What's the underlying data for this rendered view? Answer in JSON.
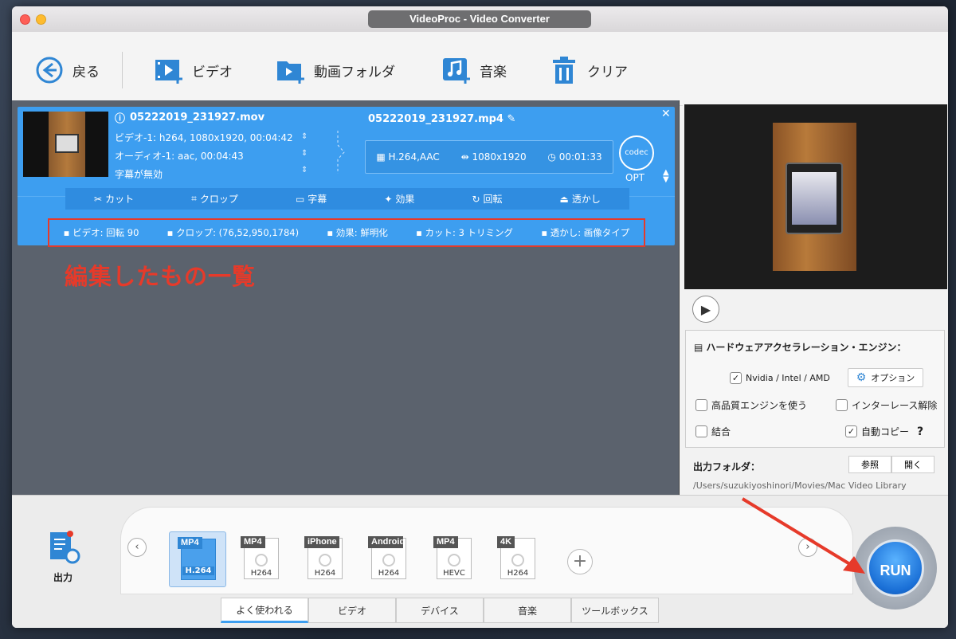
{
  "window": {
    "title": "VideoProc - Video Converter"
  },
  "toolbar": {
    "back": "戻る",
    "video": "ビデオ",
    "folder": "動画フォルダ",
    "music": "音楽",
    "clear": "クリア"
  },
  "item": {
    "src_name": "05222019_231927.mov",
    "video_track": "ビデオ-1: h264, 1080x1920, 00:04:42",
    "audio_track": "オーディオ-1: aac, 00:04:43",
    "subtitle": "字幕が無効",
    "dst_name": "05222019_231927.mp4",
    "codec": "H.264,AAC",
    "resolution": "1080x1920",
    "duration": "00:01:33",
    "codec_badge": "codec",
    "opt": "OPT"
  },
  "edit_tools": [
    "カット",
    "クロップ",
    "字幕",
    "効果",
    "回転",
    "透かし"
  ],
  "edits": [
    "ビデオ: 回転 90",
    "クロップ: (76,52,950,1784)",
    "効果: 鮮明化",
    "カット: 3 トリミング",
    "透かし: 画像タイプ"
  ],
  "annotation": "編集したもの一覧",
  "hardware": {
    "title": "ハードウェアアクセラレーション・エンジン：",
    "nvidia": "Nvidia / Intel / AMD",
    "option": "オプション",
    "hq": "高品質エンジンを使う",
    "deinterlace": "インターレース解除",
    "merge": "結合",
    "autocopy": "自動コピー",
    "help": "?"
  },
  "output": {
    "folder_label": "出力フォルダ：",
    "browse": "参照",
    "open": "開く",
    "path": "/Users/suzukiyoshinori/Movies/Mac Video Library",
    "label": "出力"
  },
  "formats": [
    {
      "tag": "MP4",
      "codec": "H.264"
    },
    {
      "tag": "MP4",
      "codec": "H264"
    },
    {
      "tag": "iPhone",
      "codec": "H264"
    },
    {
      "tag": "Android",
      "codec": "H264"
    },
    {
      "tag": "MP4",
      "codec": "HEVC"
    },
    {
      "tag": "4K",
      "codec": "H264"
    }
  ],
  "tabs": [
    "よく使われる",
    "ビデオ",
    "デバイス",
    "音楽",
    "ツールボックス"
  ],
  "run": "RUN",
  "colors": {
    "accent": "#3d9ef0",
    "annotation": "#e63a2a"
  }
}
